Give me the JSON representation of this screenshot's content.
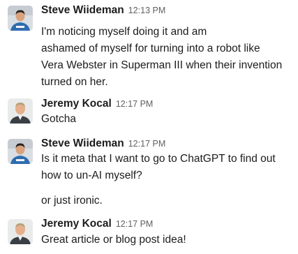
{
  "messages": [
    {
      "author": "Steve Wiideman",
      "time": "12:13 PM",
      "lines": [
        "I'm noticing myself doing it and am",
        "ashamed of myself for turning into a robot like",
        "Vera Webster in Superman III when their invention",
        "turned on her."
      ]
    },
    {
      "author": "Jeremy Kocal",
      "time": "12:17 PM",
      "lines": [
        "Gotcha"
      ]
    },
    {
      "author": "Steve Wiideman",
      "time": "12:17 PM",
      "lines": [
        "Is it meta that I want to go to ChatGPT to find out",
        "how to un-AI myself?",
        "or just ironic."
      ]
    },
    {
      "author": "Jeremy Kocal",
      "time": "12:17 PM",
      "lines": [
        "Great article or blog post idea!"
      ]
    }
  ]
}
